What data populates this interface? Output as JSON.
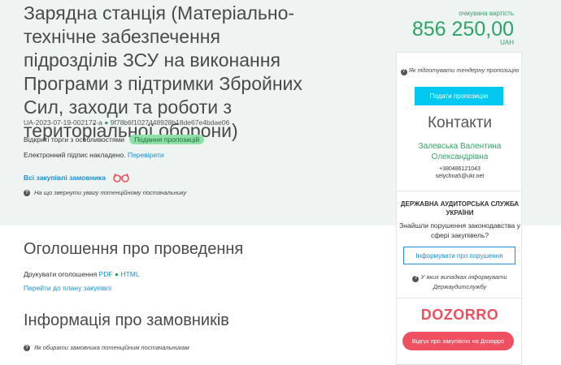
{
  "tender": {
    "title": "Зарядна станція (Матеріально-технічне забезпечення підрозділів ЗСУ на виконання Програми з підтримки Збройних Сил, заходи та роботи з територіальної оборони)",
    "id": "UA-2023-07-19-002172-a",
    "hash": "9f78b6f1027448928b18de67e4bdae06",
    "procedure": "Відкриті торги з особливостями",
    "status_badge": "Подання пропозицій",
    "signature_text": "Електронний підпис накладено.",
    "signature_link": "Перевірити",
    "all_purchases_link": "Всі закупівлі замовника",
    "attention_hint": "На що звернути увагу потенційному постачальнику"
  },
  "price": {
    "label": "очікувана вартість",
    "amount": "856 250,00",
    "currency": "UAH"
  },
  "announcement": {
    "heading": "Оголошення про проведення",
    "print_label": "Друкувати оголошення",
    "pdf_link": "PDF",
    "html_link": "HTML",
    "plan_link": "Перейти до плану закупівлі"
  },
  "customers": {
    "heading": "Інформація про замовників",
    "hint": "Як обирати замовника потенційним постачальникам"
  },
  "sidebar": {
    "tender_hint": "Як підготувати тендерну пропозицію",
    "submit_button": "Подати пропозицію",
    "contacts_heading": "Контакти",
    "contact_name": "Залевська Валентина Олександрівна",
    "contact_phone": "+380486121043",
    "contact_email": "selychna5@ukr.net",
    "dasu_heading": "ДЕРЖАВНА АУДИТОРСЬКА СЛУЖБА УКРАЇНИ",
    "dasu_question": "Знайшли порушення законодавства у сфері закупівель?",
    "inform_button": "Інформувати про порушення",
    "dasu_hint": "У яких випадках інформувати Держаудитслужбу",
    "dozorro_logo": "DOZORRO",
    "dozorro_button": "Відгук про закупівлю на Дозорро"
  },
  "icons": {
    "question": "question-circle-icon",
    "glasses": "glasses-icon"
  },
  "colors": {
    "accent_green": "#2fa365",
    "link_blue": "#1a8fd6",
    "submit_cyan": "#00c8f0",
    "dozorro_red": "#ef5060"
  }
}
